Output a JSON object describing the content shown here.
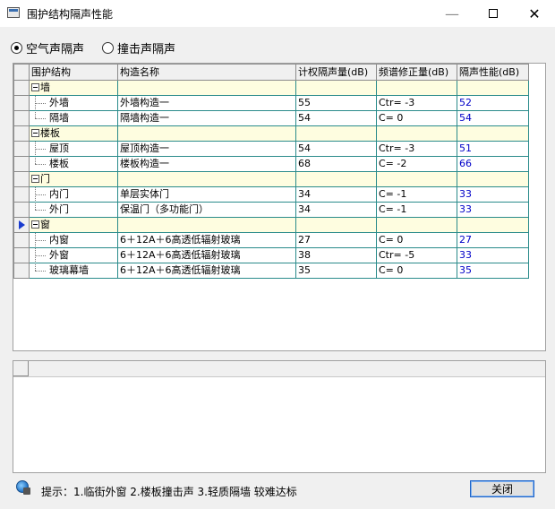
{
  "window": {
    "title": "围护结构隔声性能",
    "minimize": "—",
    "close": "✕"
  },
  "radio": {
    "airborne": "空气声隔声",
    "impact": "撞击声隔声",
    "selected": "airborne"
  },
  "columns": [
    "围护结构",
    "构造名称",
    "计权隔声量(dB)",
    "频谱修正量(dB)",
    "隔声性能(dB)"
  ],
  "rows": [
    {
      "type": "group",
      "name": "墙"
    },
    {
      "type": "item",
      "name": "外墙",
      "construction": "外墙构造一",
      "rw": "55",
      "correction": "Ctr= -3",
      "performance": "52"
    },
    {
      "type": "item",
      "name": "隔墙",
      "construction": "隔墙构造一",
      "rw": "54",
      "correction": "C= 0",
      "performance": "54",
      "last": true
    },
    {
      "type": "group",
      "name": "楼板"
    },
    {
      "type": "item",
      "name": "屋顶",
      "construction": "屋顶构造一",
      "rw": "54",
      "correction": "Ctr= -3",
      "performance": "51"
    },
    {
      "type": "item",
      "name": "楼板",
      "construction": "楼板构造一",
      "rw": "68",
      "correction": "C= -2",
      "performance": "66",
      "last": true
    },
    {
      "type": "group",
      "name": "门"
    },
    {
      "type": "item",
      "name": "内门",
      "construction": "单层实体门",
      "rw": "34",
      "correction": "C= -1",
      "performance": "33"
    },
    {
      "type": "item",
      "name": "外门",
      "construction": "保温门（多功能门）",
      "rw": "34",
      "correction": "C= -1",
      "performance": "33",
      "last": true
    },
    {
      "type": "group",
      "name": "窗",
      "current": true
    },
    {
      "type": "item",
      "name": "内窗",
      "construction": "6＋12A＋6高透低辐射玻璃",
      "rw": "27",
      "correction": "C= 0",
      "performance": "27"
    },
    {
      "type": "item",
      "name": "外窗",
      "construction": "6＋12A＋6高透低辐射玻璃",
      "rw": "38",
      "correction": "Ctr= -5",
      "performance": "33"
    },
    {
      "type": "item",
      "name": "玻璃幕墙",
      "construction": "6＋12A＋6高透低辐射玻璃",
      "rw": "35",
      "correction": "C= 0",
      "performance": "35",
      "last": true
    }
  ],
  "footer": {
    "hint": "提示：1.临街外窗 2.楼板撞击声 3.轻质隔墙 较难达标",
    "close_label": "关闭"
  },
  "colors": {
    "grid_line": "#2a8b8b",
    "group_bg": "#fefde0",
    "value_blue": "#0000c8"
  }
}
